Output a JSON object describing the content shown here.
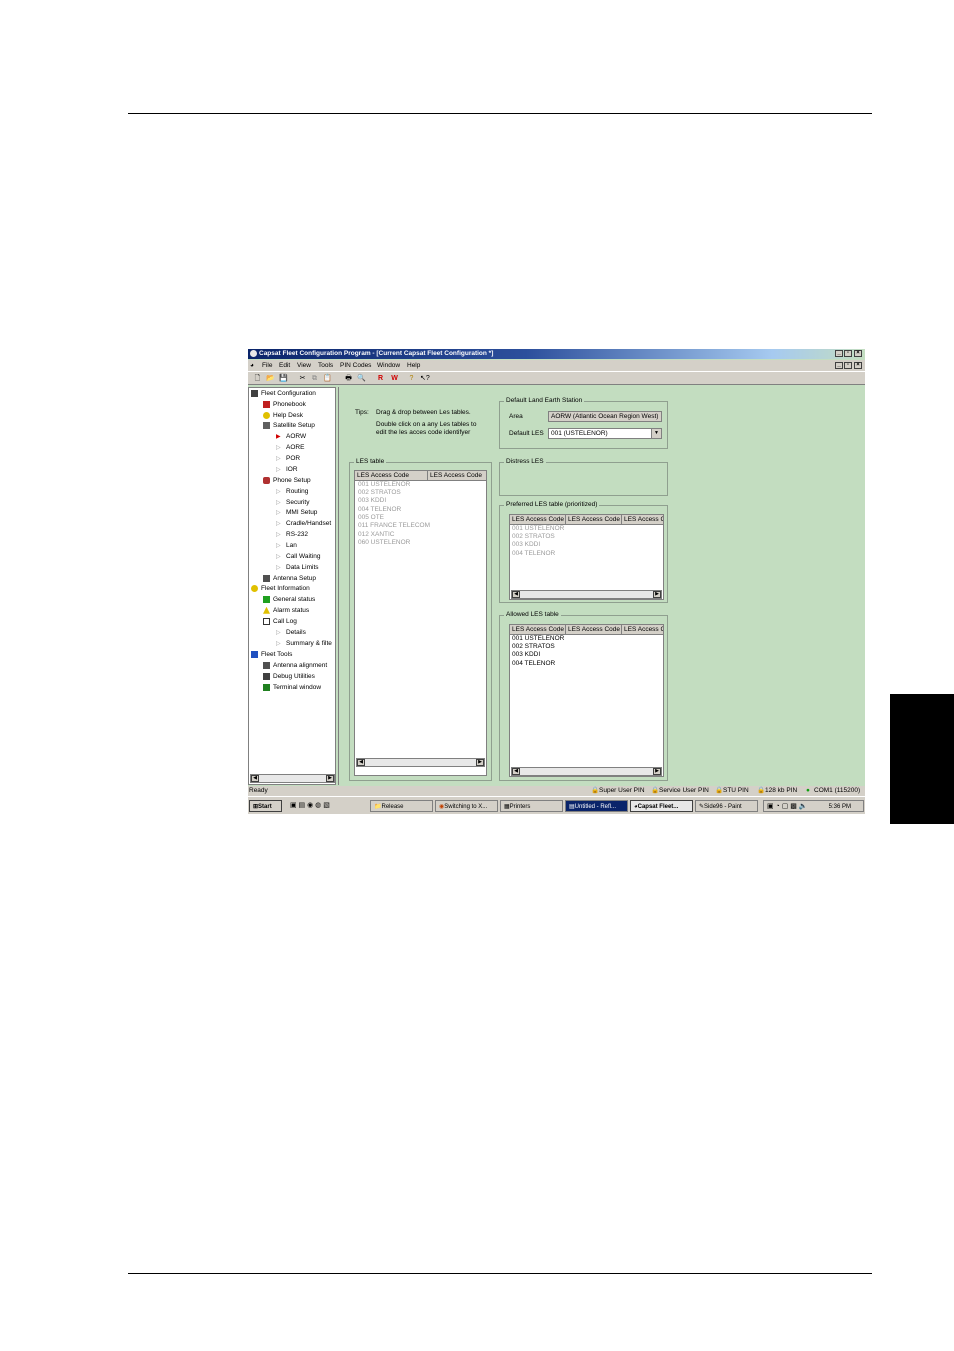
{
  "window": {
    "title": "Capsat Fleet Configuration Program - [Current Capsat Fleet Configuration *]"
  },
  "menu": [
    "File",
    "Edit",
    "View",
    "Tools",
    "PIN Codes",
    "Window",
    "Help"
  ],
  "tree": {
    "root1": "Fleet Configuration",
    "phonebook": "Phonebook",
    "helpdesk": "Help Desk",
    "satellite": "Satellite Setup",
    "aorw": "AORW",
    "aore": "AORE",
    "por": "POR",
    "ior": "IOR",
    "phone": "Phone Setup",
    "routing": "Routing",
    "security": "Security",
    "mmi": "MMI Setup",
    "cradle": "Cradle/Handset",
    "rs232": "RS-232",
    "lan": "Lan",
    "callwait": "Call Waiting",
    "datalimits": "Data Limits",
    "antenna": "Antenna Setup",
    "root2": "Fleet Information",
    "general": "General status",
    "alarm": "Alarm status",
    "calllog": "Call Log",
    "details": "Details",
    "summary": "Summary & filte",
    "root3": "Fleet Tools",
    "align": "Antenna alignment",
    "debug": "Debug Utilities",
    "terminal": "Terminal window"
  },
  "tips": {
    "label": "Tips:",
    "line1": "Drag & drop between Les tables.",
    "line2": "Double click on a any Les tables to",
    "line3": "edit the les acces code identifyer"
  },
  "les_table": {
    "legend": "LES table",
    "col1": "LES Access Code",
    "col2": "LES Access Code",
    "rows": [
      "001 USTELENOR",
      "002 STRATOS",
      "003 KDDI",
      "004 TELENOR",
      "005 OTE",
      "011 FRANCE TELECOM",
      "012 XANTIC",
      "060 USTELENOR"
    ]
  },
  "default_les": {
    "legend": "Default Land Earth Station",
    "area_label": "Area",
    "area_value": "AORW (Atlantic Ocean Region West)",
    "les_label": "Default LES",
    "les_value": "001 (USTELENOR)"
  },
  "distress": {
    "legend": "Distress LES"
  },
  "preferred": {
    "legend": "Preferred LES table (prioritized)",
    "cols": [
      "LES Access Code",
      "LES Access Code",
      "LES Access C"
    ],
    "rows": [
      "001 USTELENOR",
      "002 STRATOS",
      "003 KDDI",
      "004 TELENOR"
    ]
  },
  "allowed": {
    "legend": "Allowed LES table",
    "cols": [
      "LES Access Code",
      "LES Access Code",
      "LES Access C"
    ],
    "rows": [
      "001 USTELENOR",
      "002 STRATOS",
      "003 KDDI",
      "004 TELENOR"
    ]
  },
  "status": {
    "ready": "Ready",
    "super": "Super User PIN",
    "service": "Service User PIN",
    "stu": "STU PIN",
    "kb": "128 kb PIN",
    "com": "COM1 (115200)"
  },
  "taskbar": {
    "start": "Start",
    "release": "Release",
    "switching": "Switching to X...",
    "printers": "Printers",
    "untitled": "Untitled - Refl...",
    "capsat": "Capsat Fleet...",
    "paint": "Side96 - Paint",
    "clock": "5:36 PM"
  },
  "colors": {
    "app_bg": "#c3ddc0",
    "title_start": "#0a246a",
    "chrome": "#d4d0c8"
  }
}
